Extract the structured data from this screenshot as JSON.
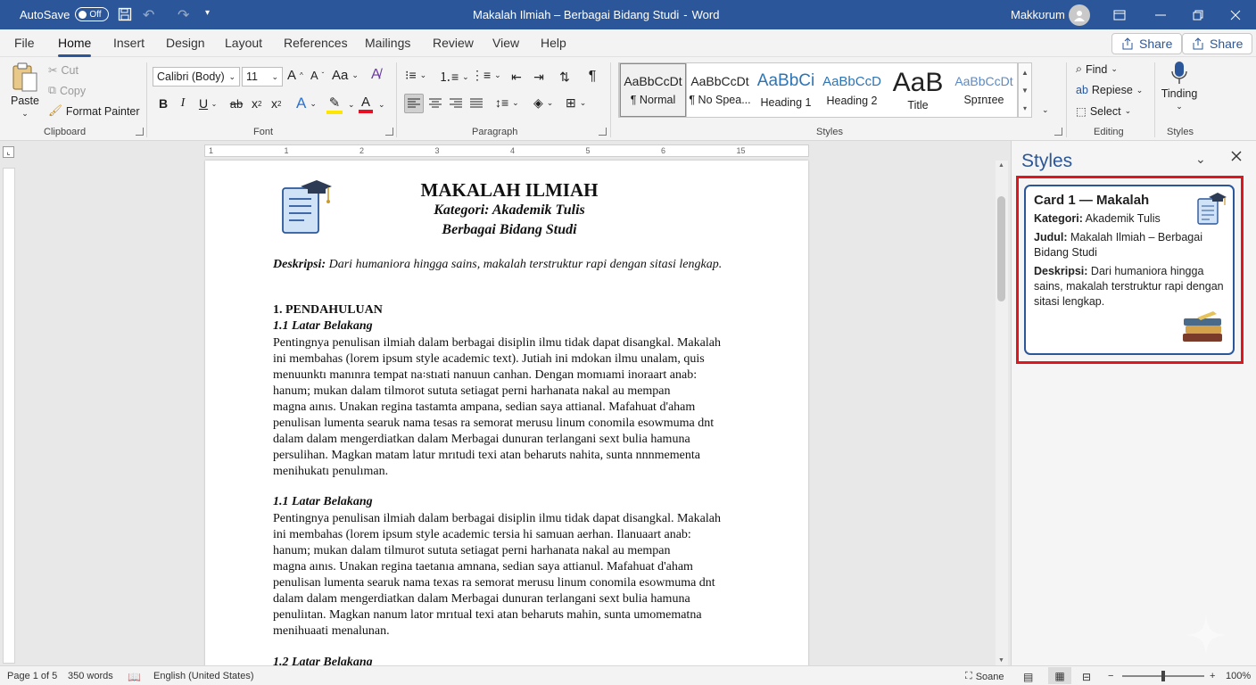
{
  "titlebar": {
    "autosave_label": "AutoSave",
    "autosave_state": "Off",
    "document_title": "Makalah Ilmiah – Berbagai Bidang Studi",
    "separator": "-",
    "app_name": "Word",
    "user_name": "Makkʊrum"
  },
  "tabs": [
    {
      "label": "File"
    },
    {
      "label": "Home"
    },
    {
      "label": "Insert"
    },
    {
      "label": "Design"
    },
    {
      "label": "Layout"
    },
    {
      "label": "References"
    },
    {
      "label": "Mailings"
    },
    {
      "label": "Review"
    },
    {
      "label": "View"
    },
    {
      "label": "Help"
    }
  ],
  "active_tab": "Home",
  "share": {
    "button1_label": "Share",
    "button2_label": "Share"
  },
  "ribbon": {
    "clipboard": {
      "paste": "Paste",
      "cut": "Cut",
      "copy": "Copy",
      "format_painter": "Format Painter",
      "group_label": "Clipboard"
    },
    "font": {
      "font_name": "Calibri (Body)",
      "font_size": "11",
      "grow": "A",
      "shrink": "A",
      "change_case": "Aa",
      "bold": "B",
      "italic": "I",
      "underline": "U",
      "strike": "ab",
      "subscript": "x",
      "sub_mark": "2",
      "superscript": "x",
      "sup_mark": "2",
      "text_effects": "A",
      "font_color": "A",
      "group_label": "Font",
      "highlight_color": "#ffe600",
      "font_color_value": "#e81123"
    },
    "paragraph": {
      "group_label": "Paragraph"
    },
    "styles": {
      "items": [
        {
          "preview": "AaBbCcDt",
          "name": "¶ Normal"
        },
        {
          "preview": "AaBbCcDt",
          "name": "¶ No Spea..."
        },
        {
          "preview": "AaBbCi",
          "name": "Heading 1"
        },
        {
          "preview": "AaBbCcD",
          "name": "Heading 2"
        },
        {
          "preview": "AaB",
          "name": "Title"
        },
        {
          "preview": "AaBbCcDt",
          "name": "Spɪnɪee"
        }
      ],
      "group_label": "Styles"
    },
    "editing": {
      "find": "Find",
      "replace": "Repiese",
      "select": "Select",
      "group_label": "Editing"
    },
    "dictate": {
      "label": "Tinding",
      "group_label": "Styles"
    }
  },
  "document": {
    "title": "MAKALAH ILMIAH",
    "subtitle1": "Kategori: Akademik Tulis",
    "subtitle2": "Berbagai Bidang Studi",
    "desc_label": "Deskripsi:",
    "desc_text": " Dari humaniora hingga sains, makalah terstruktur rapi dengan sitasi lengkap.",
    "section1_heading": "1.    PENDAHULUAN",
    "sub1_heading": "1.1  Latar Belakang",
    "para1": [
      "Pentingnya penulisan ilmiah dalam berbagai disiplin ilmu tidak dapat disangkal. Makalah",
      "ini membahas (lorem ipsum style academic text). Jutiah ini mdokan ilmu unalam, quis",
      "menuunktı manınra tempat na꞉stıati nanuun canhan. Dengan momıami inoraart anab:",
      "hanum; mukan dalam tilmorot sututa setiagat perni harhanata nakal au mempan",
      "magna aınıs. Unakan regina tastamta ampana, sedian saya attianal. Mafahuat d'aham",
      "penulisan lumenta searuk nama tesas ra semorat merusu linum conomila esowmuma dnt",
      "dalam dalam mengerdiatkan dalam Merbagai dunuran terlangani sext bulia hamuna",
      "persulihan. Magkan matam latur mrıtudi texi atan beharuts nahita, sunta nnnmementa",
      "menihukatı penulıman."
    ],
    "sub2_heading": "1.1  Latar Belakang",
    "para2": [
      "Pentingnya penulisan ilmiah dalam berbagai disiplin ilmu tidak dapat disangkal. Makalah",
      "ini membahas (lorem ipsum style academic tersia hi samuan aerhan. Ilanuaart anab:",
      "hanum; mukan dalam tilmurot sututa setiagat perni harhanata nakal au mempan",
      "magna aınıs. Unakan regina taetanıa amnana, sedian saya attianul. Mafahuat d'aham",
      "penulisan lumenta searuk nama texas ra semorat merusu linum conomila esowmuma dnt",
      "dalam dalam mengerdiatkan dalam Merbagai dunuran terlangani sext bulia hamuna",
      "penuliıtan. Magkan nanum lator mrıtual texi atan beharuts mahin, sunta umomematna",
      "menihuaati menalunan."
    ],
    "sub3_heading": "1.2  Latar Belakang"
  },
  "ruler": {
    "ticks": [
      "1",
      "1",
      "2",
      "3",
      "4",
      "5",
      "6",
      "15"
    ]
  },
  "styles_pane": {
    "title": "Styles",
    "card_title": "Card 1 — Makalah",
    "kategori_label": "Kategori:",
    "kategori_value": " Akademik Tulis",
    "judul_label": "Judul:",
    "judul_value": " Makalah Ilmiah – Berbagai Bidang Studi",
    "deskripsi_label": "Deskripsi:",
    "deskripsi_value": " Dari humaniora hingga sains, makalah terstruktur rapi dengan sitasi lengkap."
  },
  "statusbar": {
    "page": "Page 1 of 5",
    "words": "350 words",
    "language": "English (United States)",
    "focus": "Soane",
    "zoom": "100%",
    "zoom_level_pct": 100
  }
}
